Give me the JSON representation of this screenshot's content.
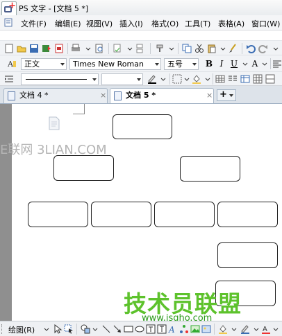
{
  "window": {
    "title": "PS 文字 - [文档 5 *]"
  },
  "menu": {
    "items": [
      "文件(F)",
      "编辑(E)",
      "视图(V)",
      "插入(I)",
      "格式(O)",
      "工具(T)",
      "表格(A)",
      "窗口(W)"
    ]
  },
  "format_bar": {
    "style_value": "正文",
    "font_value": "Times New Roman",
    "size_value": "五号",
    "bold": "B",
    "italic": "I",
    "underline": "U",
    "font_color": "A"
  },
  "tabs": [
    {
      "label": "文档 4 *",
      "active": false
    },
    {
      "label": "文档 5 *",
      "active": true
    }
  ],
  "tab_add_label": "+",
  "drawing_bar": {
    "label": "绘图(R)"
  },
  "watermarks": {
    "site_cn": "E联网 3LIAN.COM",
    "site_brand": "技术员联盟",
    "site_url": "www.jsgho.com"
  },
  "colors": {
    "accent": "#4a6fa5",
    "brand_green": "#5dc22c"
  }
}
